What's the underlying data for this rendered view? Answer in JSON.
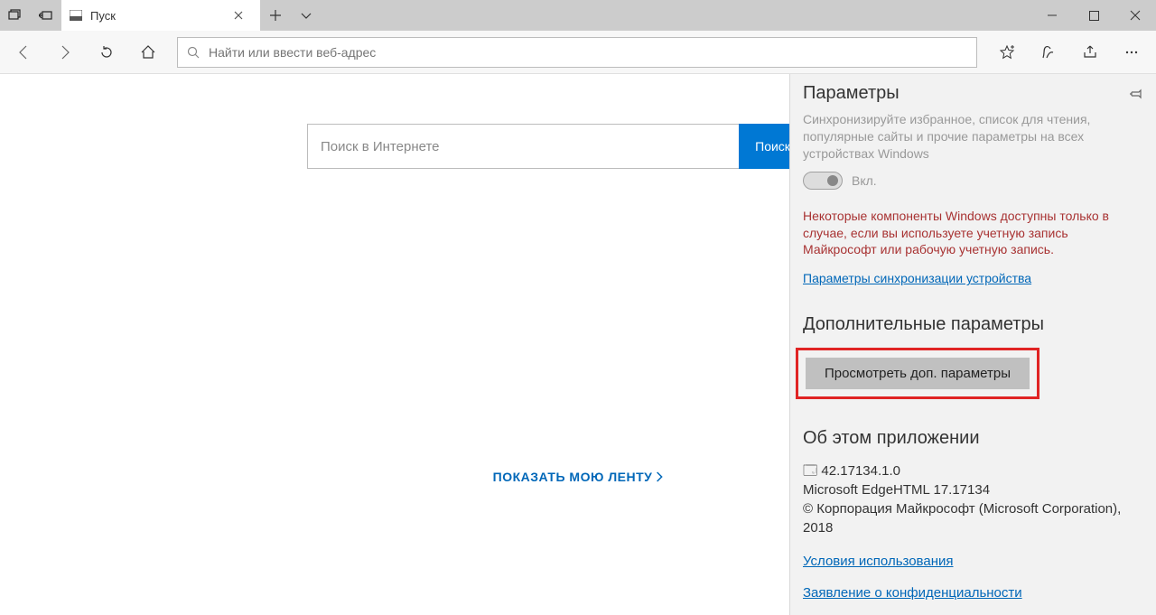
{
  "titlebar": {
    "tab_title": "Пуск"
  },
  "navbar": {
    "placeholder": "Найти или ввести веб-адрес"
  },
  "content": {
    "search_placeholder": "Поиск в Интернете",
    "search_button": "Поиск в Инте",
    "feed_link": "ПОКАЗАТЬ МОЮ ЛЕНТУ"
  },
  "flyout": {
    "title": "Параметры",
    "sync_desc": "Синхронизируйте избранное, список для чтения, популярные сайты и прочие параметры на всех устройствах Windows",
    "toggle_label": "Вкл.",
    "red_note": "Некоторые компоненты Windows доступны только в случае, если вы используете учетную запись Майкрософт или рабочую учетную запись.",
    "sync_link": "Параметры синхронизации устройства",
    "advanced_heading": "Дополнительные параметры",
    "advanced_button": "Просмотреть доп. параметры",
    "about_heading": "Об этом приложении",
    "about_version": "🗔 42.17134.1.0",
    "about_engine": "Microsoft EdgeHTML 17.17134",
    "about_copyright": "© Корпорация Майкрософт (Microsoft Corporation), 2018",
    "terms_link": "Условия использования",
    "privacy_link": "Заявление о конфиденциальности"
  }
}
